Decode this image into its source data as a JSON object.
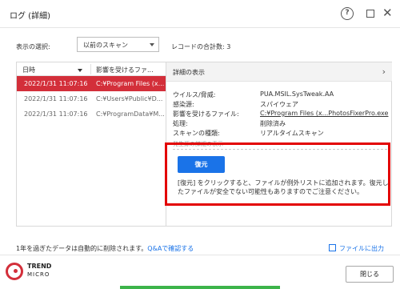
{
  "window": {
    "title": "ログ (詳細)",
    "help_glyph": "?",
    "maximize_glyph": "",
    "close_glyph": "✕"
  },
  "filter": {
    "label": "表示の選択:",
    "selected": "以前のスキャン",
    "record_count": "レコードの合計数: 3"
  },
  "list": {
    "col_date": "日時",
    "col_file": "影響を受けるファ...",
    "rows": [
      {
        "date": "2022/1/31 11:07:16",
        "path": "C:¥Program Files (x...",
        "selected": true
      },
      {
        "date": "2022/1/31 11:07:16",
        "path": "C:¥Users¥Public¥D...",
        "selected": false
      },
      {
        "date": "2022/1/31 11:07:16",
        "path": "C:¥ProgramData¥M...",
        "selected": false
      }
    ]
  },
  "detail": {
    "header": "詳細の表示",
    "chevron": "›",
    "fields": [
      {
        "key": "ウイルス/脅威:",
        "value": "PUA.MSIL.SysTweak.AA"
      },
      {
        "key": "感染源:",
        "value": "スパイウェア"
      },
      {
        "key": "影響を受けるファイル:",
        "value": "C:¥Program Files (x...PhotosFixerPro.exe"
      },
      {
        "key": "処理:",
        "value": "削除済み"
      },
      {
        "key": "スキャンの種類:",
        "value": "リアルタイムスキャン"
      }
    ],
    "mini_text": "発生源の詳細の表示",
    "restore_button": "復元",
    "note": "[復元] をクリックすると、ファイルが例外リストに追加されます。復元したファイルが安全でない可能性もありますのでご注意ください。"
  },
  "footer": {
    "retention_text": "1年を過ぎたデータは自動的に削除されます。",
    "retention_link": "Q&Aで確認する",
    "export": "ファイルに出力",
    "brand_top": "TREND",
    "brand_bottom": "MICRO",
    "close_button": "閉じる"
  },
  "colors": {
    "accent_red": "#d32f3a",
    "highlight_box": "#e30000",
    "button_blue": "#1a73e8"
  }
}
